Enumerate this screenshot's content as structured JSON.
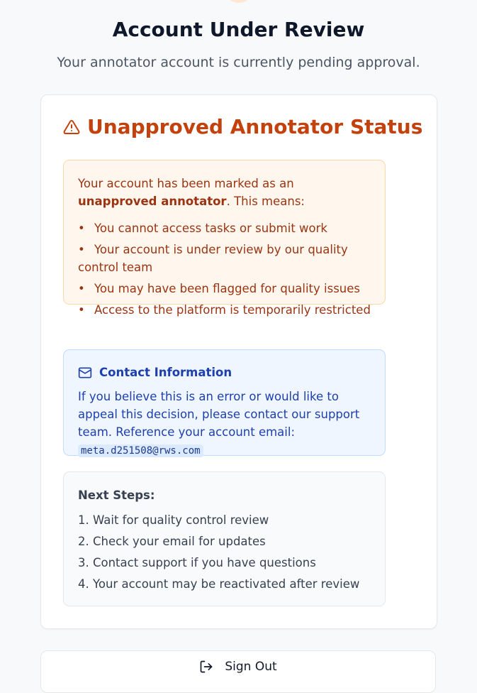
{
  "header": {
    "title": "Account Under Review",
    "subtitle": "Your annotator account is currently pending approval."
  },
  "status": {
    "heading": "Unapproved Annotator Status",
    "icon": "warning-triangle-icon",
    "intro_prefix": "Your account has been marked as an ",
    "intro_bold": "unapproved annotator",
    "intro_suffix": ". This means:",
    "bullet": "•",
    "items": [
      "You cannot access tasks or submit work",
      "Your account is under review by our quality control team",
      "You may have been flagged for quality issues",
      "Access to the platform is temporarily restricted"
    ]
  },
  "contact": {
    "icon": "mail-icon",
    "heading": "Contact Information",
    "text": "If you believe this is an error or would like to appeal this decision, please contact our support team. Reference your account email:",
    "email": "meta.d251508@rws.com"
  },
  "next_steps": {
    "heading": "Next Steps:",
    "items": [
      "1. Wait for quality control review",
      "2. Check your email for updates",
      "3. Contact support if you have questions",
      "4. Your account may be reactivated after review"
    ]
  },
  "signout": {
    "icon": "sign-out-icon",
    "label": "Sign Out"
  },
  "colors": {
    "warning_heading": "#c2410c",
    "warning_text": "#9a3412",
    "warning_bg": "#fff7ed",
    "info_text": "#1e40af",
    "info_bg": "#eff6ff"
  }
}
